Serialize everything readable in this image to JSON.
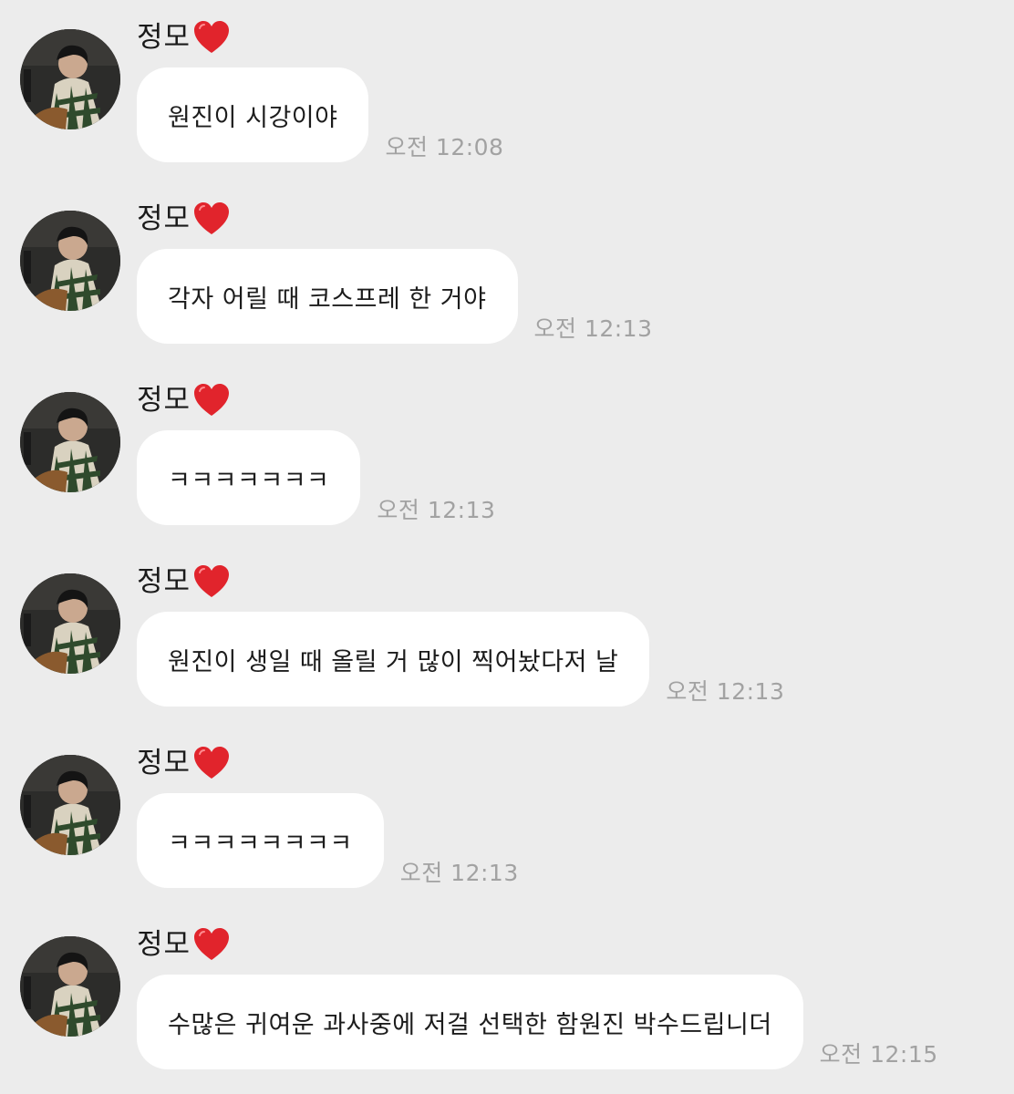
{
  "chat": {
    "messages": [
      {
        "sender": "정모",
        "text": "원진이 시강이야",
        "time": "오전 12:08"
      },
      {
        "sender": "정모",
        "text": "각자 어릴 때 코스프레 한 거야",
        "time": "오전 12:13"
      },
      {
        "sender": "정모",
        "text": "ㅋㅋㅋㅋㅋㅋㅋ",
        "time": "오전 12:13"
      },
      {
        "sender": "정모",
        "text": "원진이 생일 때 올릴 거 많이 찍어놨다저 날",
        "time": "오전 12:13"
      },
      {
        "sender": "정모",
        "text": "ㅋㅋㅋㅋㅋㅋㅋㅋ",
        "time": "오전 12:13"
      },
      {
        "sender": "정모",
        "text": "수많은 귀여운 과사중에 저걸 선택한 함원진 박수드립니더",
        "time": "오전 12:15"
      }
    ]
  },
  "icons": {
    "avatar": "profile-photo",
    "heart": "red-heart-emoji"
  },
  "colors": {
    "background": "#ececec",
    "bubble": "#ffffff",
    "timestamp": "#a2a2a2",
    "heart": "#e1242c"
  }
}
